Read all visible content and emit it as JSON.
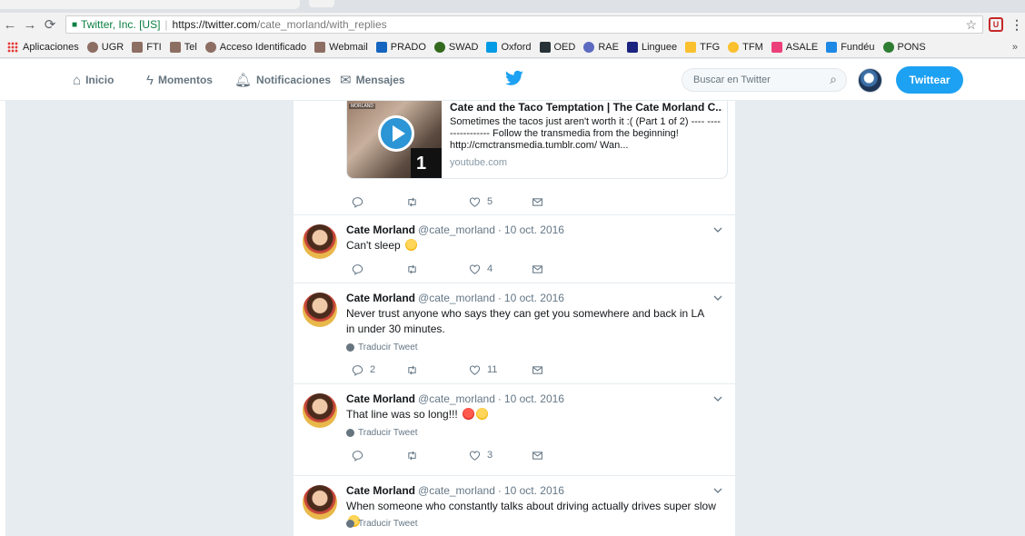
{
  "browser": {
    "secure_label": "Twitter, Inc. [US]",
    "url_host": "https://twitter.com",
    "url_path": "/cate_morland/with_replies",
    "ext_label": "U"
  },
  "bookmarks": [
    {
      "label": "Aplicaciones",
      "color": "#e53935"
    },
    {
      "label": "UGR",
      "color": "#8d6e63"
    },
    {
      "label": "FTI",
      "color": "#8d6e63"
    },
    {
      "label": "Tel",
      "color": "#8d6e63"
    },
    {
      "label": "Acceso Identificado",
      "color": "#8d6e63"
    },
    {
      "label": "Webmail",
      "color": "#8d6e63"
    },
    {
      "label": "PRADO",
      "color": "#1565c0"
    },
    {
      "label": "SWAD",
      "color": "#33691e"
    },
    {
      "label": "Oxford",
      "color": "#039be5"
    },
    {
      "label": "OED",
      "color": "#263238"
    },
    {
      "label": "RAE",
      "color": "#5c6bc0"
    },
    {
      "label": "Linguee",
      "color": "#1a237e"
    },
    {
      "label": "TFG",
      "color": "#fbc02d"
    },
    {
      "label": "TFM",
      "color": "#fbc02d"
    },
    {
      "label": "ASALE",
      "color": "#ec407a"
    },
    {
      "label": "Fundéu",
      "color": "#1e88e5"
    },
    {
      "label": "PONS",
      "color": "#2e7d32"
    }
  ],
  "bookmarks_more": "»",
  "nav": {
    "home": "Inicio",
    "moments": "Momentos",
    "notifications": "Notificaciones",
    "messages": "Mensajes",
    "search_placeholder": "Buscar en Twitter",
    "tweet_button": "Twittear"
  },
  "card": {
    "title": "Cate and the Taco Temptation | The Cate Morland C...",
    "description": "Sometimes the tacos just aren't worth it :( (Part 1 of 2) ---- ---------------- Follow the transmedia from the beginning! http://cmctransmedia.tumblr.com/ Wan...",
    "domain": "youtube.com",
    "thumb_label": "MORLAND",
    "thumb_corner": "1"
  },
  "first_actions": {
    "reply": "",
    "retweet": "",
    "like": "5"
  },
  "translate_label": "Traducir Tweet",
  "tweets": [
    {
      "name": "Cate Morland",
      "handle": "@cate_morland",
      "date": "10 oct. 2016",
      "text": "Can't sleep",
      "reply": "",
      "retweet": "",
      "like": "4"
    },
    {
      "name": "Cate Morland",
      "handle": "@cate_morland",
      "date": "10 oct. 2016",
      "text": "Never trust anyone who says they can get you somewhere and back in LA in under 30 minutes.",
      "reply": "2",
      "retweet": "",
      "like": "11"
    },
    {
      "name": "Cate Morland",
      "handle": "@cate_morland",
      "date": "10 oct. 2016",
      "text": "That line was so long!!!",
      "reply": "",
      "retweet": "",
      "like": "3"
    },
    {
      "name": "Cate Morland",
      "handle": "@cate_morland",
      "date": "10 oct. 2016",
      "text": "When someone who constantly talks about driving actually drives super slow"
    }
  ]
}
